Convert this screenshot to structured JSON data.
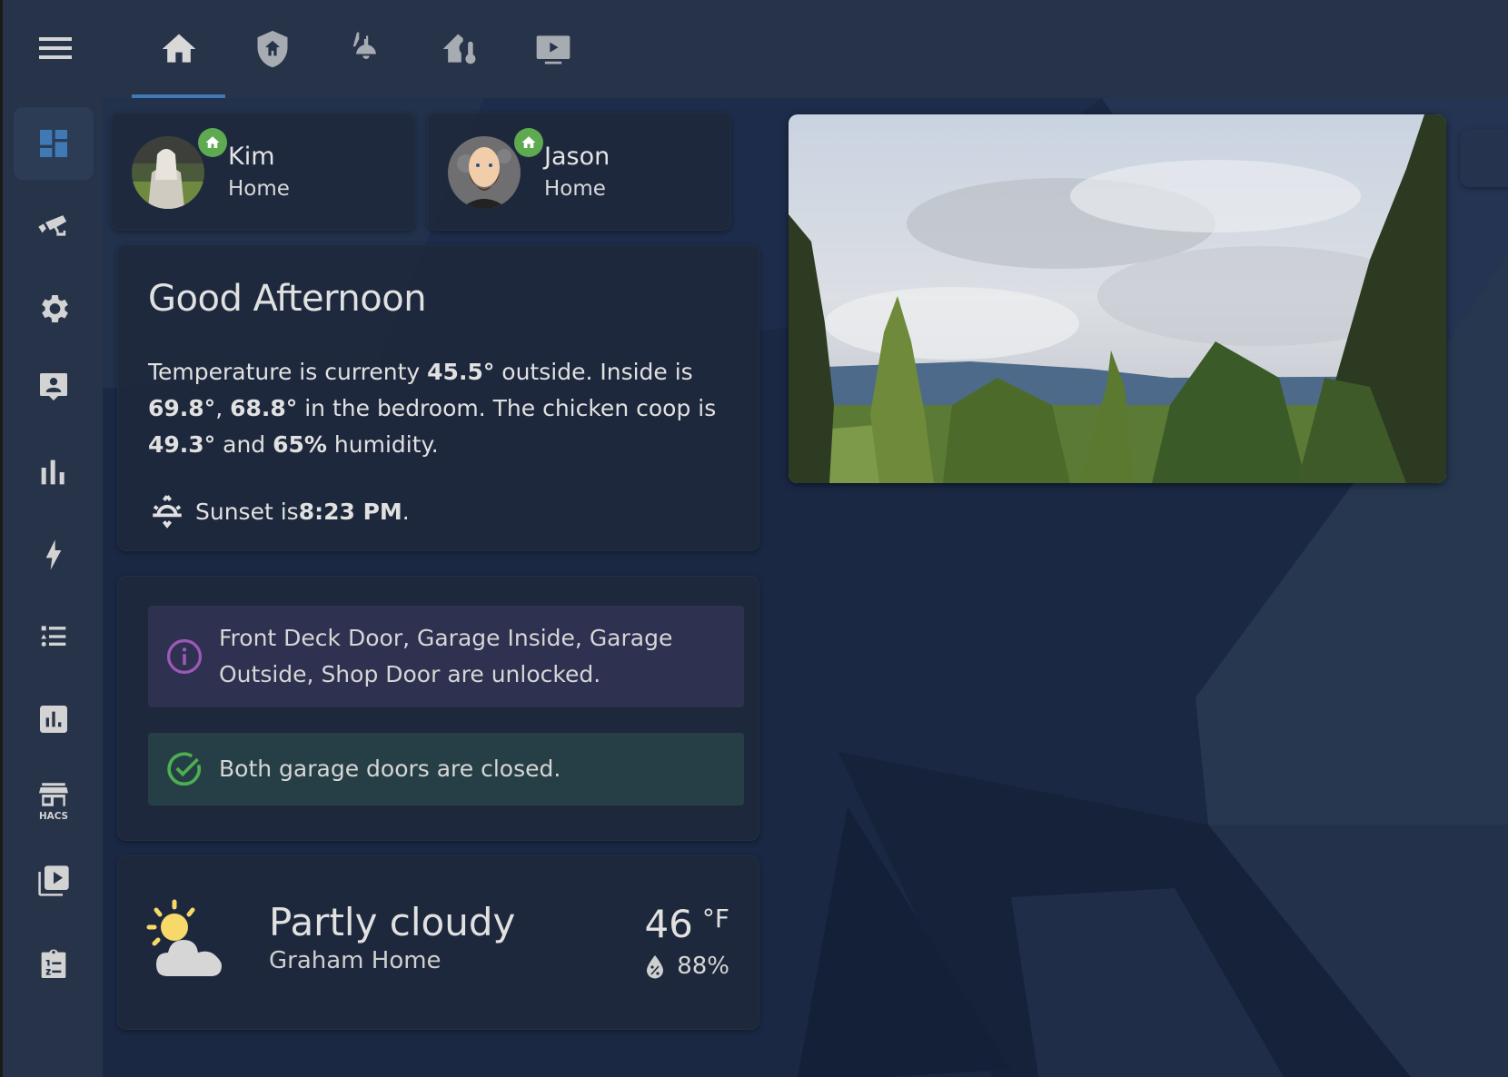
{
  "header": {
    "menu_icon": "hamburger-menu-icon",
    "tabs": [
      {
        "name": "home",
        "icon": "home-icon",
        "active": true
      },
      {
        "name": "security",
        "icon": "shield-home-icon",
        "active": false
      },
      {
        "name": "lights",
        "icon": "ceiling-light-icon",
        "active": false
      },
      {
        "name": "climate",
        "icon": "home-thermometer-icon",
        "active": false
      },
      {
        "name": "media",
        "icon": "television-play-icon",
        "active": false
      }
    ]
  },
  "sidebar": {
    "items": [
      {
        "name": "overview",
        "icon": "view-dashboard-icon",
        "active": true
      },
      {
        "name": "cameras",
        "icon": "cctv-icon",
        "active": false
      },
      {
        "name": "settings",
        "icon": "cog-icon",
        "active": false
      },
      {
        "name": "people",
        "icon": "account-box-icon",
        "active": false
      },
      {
        "name": "history",
        "icon": "chart-bar-icon",
        "active": false
      },
      {
        "name": "energy",
        "icon": "lightning-bolt-icon",
        "active": false
      },
      {
        "name": "logbook",
        "icon": "format-list-bulleted-type-icon",
        "active": false
      },
      {
        "name": "statistics",
        "icon": "chart-box-icon",
        "active": false
      },
      {
        "name": "hacs",
        "icon": "hacs-store-icon",
        "label": "HACS",
        "active": false
      },
      {
        "name": "media",
        "icon": "play-box-multiple-icon",
        "active": false
      },
      {
        "name": "todo",
        "icon": "clipboard-list-icon",
        "active": false
      }
    ]
  },
  "people": [
    {
      "name": "Kim",
      "state": "Home",
      "badge_icon": "home-icon"
    },
    {
      "name": "Jason",
      "state": "Home",
      "badge_icon": "home-icon"
    }
  ],
  "greeting": {
    "title": "Good Afternoon",
    "p1": "Temperature is currenty ",
    "outside_temp": "45.5°",
    "p2": " outside. Inside is ",
    "inside_temp": "69.8°",
    "p3": ", ",
    "bedroom_temp": "68.8°",
    "p4": " in the bedroom. The chicken coop is ",
    "coop_temp": "49.3°",
    "p5": " and ",
    "coop_humidity": "65%",
    "p6": " humidity.",
    "sunset_prefix": "Sunset is ",
    "sunset_time": "8:23 PM",
    "sunset_suffix": "."
  },
  "alerts": [
    {
      "type": "info",
      "icon": "information-outline-icon",
      "text": "Front Deck Door, Garage Inside, Garage Outside, Shop Door are unlocked."
    },
    {
      "type": "success",
      "icon": "check-circle-outline-icon",
      "text": "Both garage doors are closed."
    }
  ],
  "weather": {
    "condition": "Partly cloudy",
    "location": "Graham Home",
    "temperature": "46",
    "unit": "°F",
    "humidity": "88%",
    "icon": "partly-cloudy-icon"
  },
  "camera": {
    "name": "backyard-camera-feed"
  },
  "colors": {
    "accent": "#3f7ab7",
    "badge_home": "#5eaa50",
    "info": "#9b59b6",
    "success": "#4caf50",
    "sun": "#f7d96a"
  }
}
